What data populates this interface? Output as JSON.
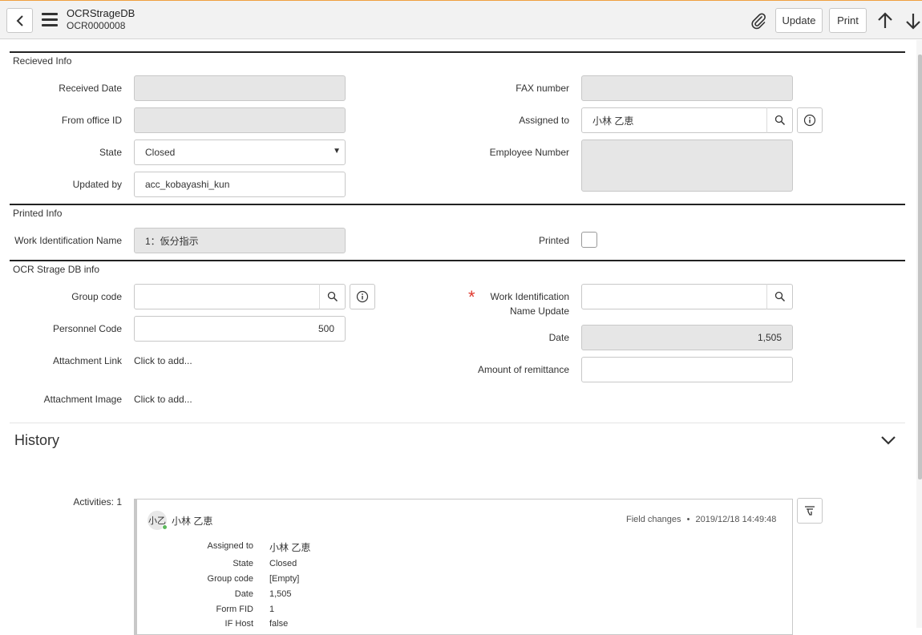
{
  "header": {
    "title": "OCRStrageDB",
    "record_number": "OCR0000008",
    "update_label": "Update",
    "print_label": "Print"
  },
  "received_info": {
    "title": "Recieved Info",
    "received_date_label": "Received Date",
    "received_date_value": "",
    "from_office_label": "From office ID",
    "from_office_value": "",
    "state_label": "State",
    "state_value": "Closed",
    "updated_by_label": "Updated by",
    "updated_by_value": "acc_kobayashi_kun",
    "fax_label": "FAX number",
    "fax_value": "",
    "assigned_to_label": "Assigned to",
    "assigned_to_value": "小林 乙恵",
    "employee_number_label": "Employee Number",
    "employee_number_value": ""
  },
  "printed_info": {
    "title": "Printed Info",
    "work_id_name_label": "Work Identification Name",
    "work_id_name_value": "1：仮分指示",
    "printed_label": "Printed",
    "printed_checked": false
  },
  "ocr_info": {
    "title": "OCR Strage DB info",
    "group_code_label": "Group code",
    "group_code_value": "",
    "personnel_code_label": "Personnel Code",
    "personnel_code_value": "500",
    "attachment_link_label": "Attachment Link",
    "attachment_link_value": "Click to add...",
    "attachment_image_label": "Attachment Image",
    "attachment_image_value": "Click to add...",
    "work_id_update_label_1": "Work Identification",
    "work_id_update_label_2": "Name Update",
    "required_mark": "*",
    "work_id_update_value": "",
    "date_label": "Date",
    "date_value": "1,505",
    "remittance_label": "Amount of remittance",
    "remittance_value": ""
  },
  "history": {
    "title": "History",
    "activities_label": "Activities: 1",
    "entry": {
      "avatar_initials": "小乙",
      "user": "小林 乙恵",
      "type": "Field changes",
      "separator": "•",
      "timestamp": "2019/12/18 14:49:48",
      "rows": [
        {
          "label": "Assigned to",
          "value": "小林 乙恵"
        },
        {
          "label": "State",
          "value": "Closed"
        },
        {
          "label": "Group code",
          "value": "[Empty]"
        },
        {
          "label": "Date",
          "value": "1,505"
        },
        {
          "label": "Form FID",
          "value": "1"
        },
        {
          "label": "IF Host",
          "value": "false"
        }
      ]
    }
  },
  "colors": {
    "accent_top": "#f0a040",
    "required": "#e0382e",
    "online": "#5cb85c"
  }
}
